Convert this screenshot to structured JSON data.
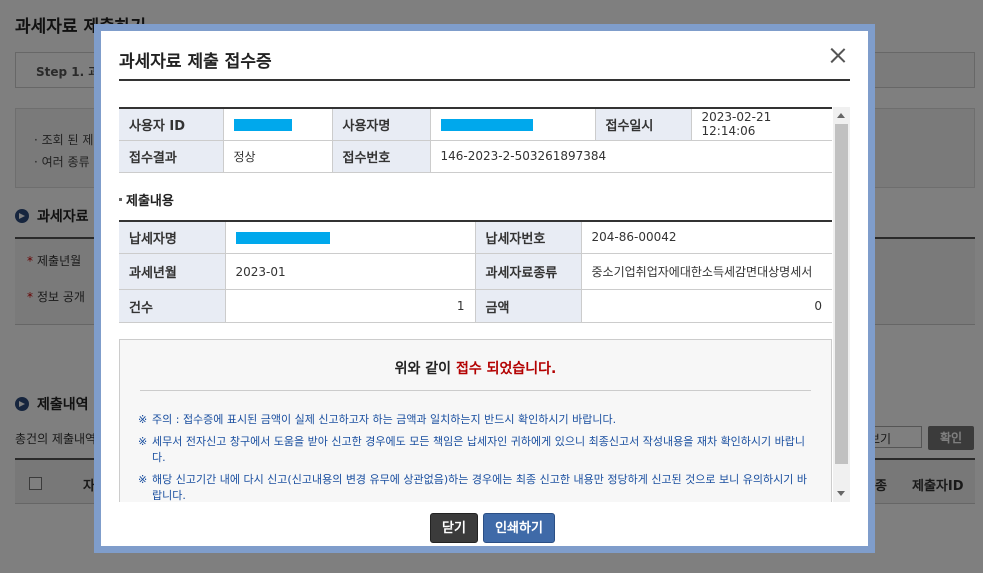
{
  "background": {
    "page_title": "과세자료 제출하기",
    "step_label": "Step 1. 과",
    "info_lines": [
      "· 조회 된 제",
      "· 여러 종류"
    ],
    "section1_title": "과세자료",
    "form_rows": [
      "제출년월",
      "정보 공개"
    ],
    "section2_title": "제출내역",
    "count_text": "총건의 제출내역",
    "select_value": "보기",
    "confirm_label": "확인",
    "table_headers": [
      "자",
      "종",
      "제출자ID"
    ]
  },
  "modal": {
    "title": "과세자료 제출 접수증",
    "receipt": {
      "user_id_label": "사용자 ID",
      "user_name_label": "사용자명",
      "received_at_label": "접수일시",
      "received_at": "2023-02-21 12:14:06",
      "result_label": "접수결과",
      "result": "정상",
      "receipt_no_label": "접수번호",
      "receipt_no": "146-2023-2-503261897384"
    },
    "submission_heading": "제출내용",
    "submission": {
      "taxpayer_name_label": "납세자명",
      "taxpayer_no_label": "납세자번호",
      "taxpayer_no": "204-86-00042",
      "tax_period_label": "과세년월",
      "tax_period": "2023-01",
      "tax_data_type_label": "과세자료종류",
      "tax_data_type": "중소기업취업자에대한소득세감면대상명세서",
      "count_label": "건수",
      "count": "1",
      "amount_label": "금액",
      "amount": "0"
    },
    "notice": {
      "headline_pre": "위와 같이 ",
      "headline_red": "접수 되었습니다.",
      "mark": "※",
      "items": [
        "주의 : 접수증에 표시된 금액이 실제 신고하고자 하는 금액과 일치하는지 반드시 확인하시기 바랍니다.",
        "세무서 전자신고 창구에서 도움을 받아 신고한 경우에도 모든 책임은 납세자인 귀하에게 있으니 최종신고서 작성내용을 재차 확인하시기 바랍니다.",
        "해당 신고기간 내에 다시 신고(신고내용의 변경 유무에 상관없음)하는 경우에는 최종 신고한 내용만 정당하게 신고된 것으로 보니 유의하시기 바랍니다."
      ]
    },
    "buttons": {
      "close": "닫기",
      "print": "인쇄하기"
    }
  },
  "colors": {
    "mask": "#00a8ec",
    "border_blue": "#7f9dcb",
    "notice_text": "#1a4fa0",
    "accent_red": "#b30000"
  }
}
